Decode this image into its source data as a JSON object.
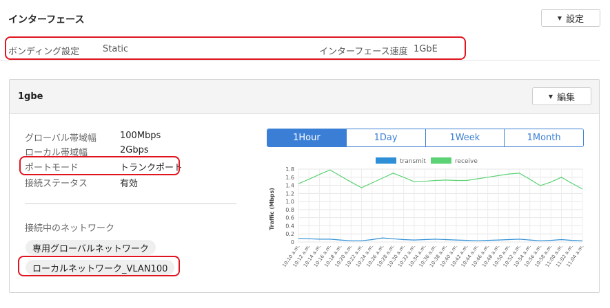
{
  "header": {
    "title": "インターフェース",
    "settings_label": "設定"
  },
  "bonding": {
    "label": "ボンディング設定",
    "value": "Static",
    "speed_label": "インターフェース速度",
    "speed_value": "1GbE"
  },
  "panel": {
    "title": "1gbe",
    "edit_label": "編集",
    "fields": [
      {
        "label": "グローバル帯域幅",
        "value": "100Mbps"
      },
      {
        "label": "ローカル帯域幅",
        "value": "2Gbps"
      },
      {
        "label": "ポートモード",
        "value": "トランクポート"
      },
      {
        "label": "接続ステータス",
        "value": "有効"
      }
    ],
    "connected_label": "接続中のネットワーク",
    "networks": [
      "専用グローバルネットワーク",
      "ローカルネットワーク_VLAN100"
    ]
  },
  "tabs": [
    {
      "label": "1Hour",
      "active": true
    },
    {
      "label": "1Day",
      "active": false
    },
    {
      "label": "1Week",
      "active": false
    },
    {
      "label": "1Month",
      "active": false
    }
  ],
  "colors": {
    "accent": "#3a7fd5",
    "highlight": "#e0141e",
    "transmit": "#2f8fd6",
    "receive": "#5bd274"
  },
  "chart_data": {
    "type": "line",
    "ylabel": "Traffic (Mbps)",
    "ylim": [
      0,
      1.8
    ],
    "yticks": [
      "0",
      "0.2",
      "0.4",
      "0.6",
      "0.8",
      "1.0",
      "1.2",
      "1.4",
      "1.6",
      "1.8"
    ],
    "grid": true,
    "legend": "top",
    "x": [
      "10:10 a.m.",
      "10:12 a.m.",
      "10:14 a.m.",
      "10:16 a.m.",
      "10:18 a.m.",
      "10:20 a.m.",
      "10:22 a.m.",
      "10:24 a.m.",
      "10:26 a.m.",
      "10:28 a.m.",
      "10:30 a.m.",
      "10:32 a.m.",
      "10:34 a.m.",
      "10:36 a.m.",
      "10:38 a.m.",
      "10:40 a.m.",
      "10:42 a.m.",
      "10:44 a.m.",
      "10:46 a.m.",
      "10:48 a.m.",
      "10:50 a.m.",
      "10:52 a.m.",
      "10:54 a.m.",
      "10:56 a.m.",
      "10:58 a.m.",
      "11:00 a.m.",
      "11:02 a.m.",
      "11:04 a.m."
    ],
    "series": [
      {
        "name": "transmit",
        "color": "#2f8fd6",
        "values": [
          0.09,
          0.08,
          0.07,
          0.07,
          0.05,
          0.03,
          0.03,
          0.06,
          0.1,
          0.08,
          0.06,
          0.05,
          0.06,
          0.07,
          0.06,
          0.05,
          0.04,
          0.03,
          0.04,
          0.05,
          0.06,
          0.07,
          0.05,
          0.03,
          0.04,
          0.06,
          0.04,
          0.03
        ]
      },
      {
        "name": "receive",
        "color": "#5bd274",
        "values": [
          1.44,
          1.55,
          1.67,
          1.78,
          1.63,
          1.48,
          1.34,
          1.46,
          1.58,
          1.7,
          1.6,
          1.49,
          1.5,
          1.52,
          1.53,
          1.52,
          1.52,
          1.56,
          1.6,
          1.64,
          1.68,
          1.7,
          1.55,
          1.39,
          1.48,
          1.6,
          1.45,
          1.31
        ]
      }
    ]
  }
}
